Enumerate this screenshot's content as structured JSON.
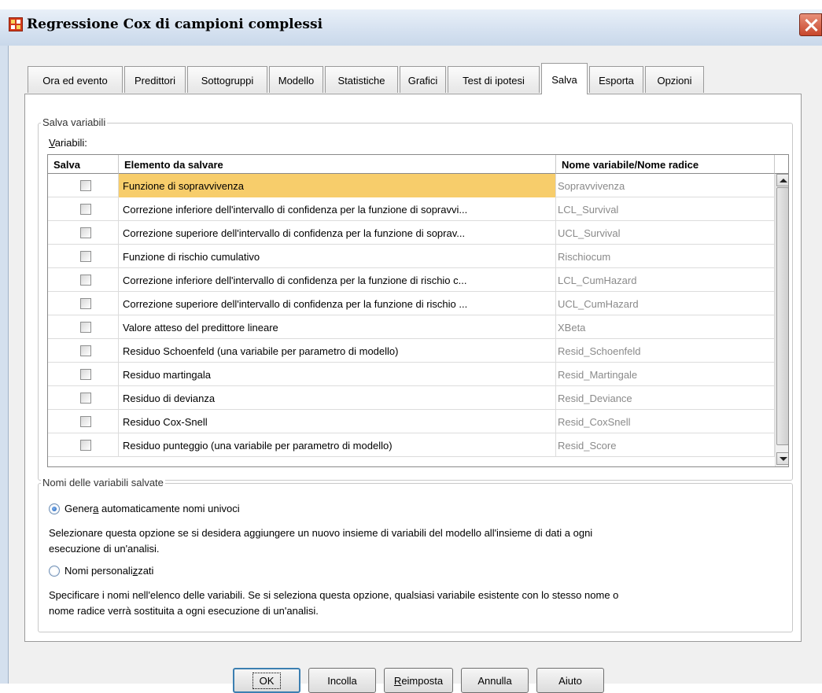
{
  "window": {
    "title": "Regressione Cox di campioni complessi"
  },
  "tabs": [
    {
      "label": "Ora ed evento"
    },
    {
      "label": "Predittori"
    },
    {
      "label": "Sottogruppi"
    },
    {
      "label": "Modello"
    },
    {
      "label": "Statistiche"
    },
    {
      "label": "Grafici"
    },
    {
      "label": "Test di ipotesi"
    },
    {
      "label": "Salva"
    },
    {
      "label": "Esporta"
    },
    {
      "label": "Opzioni"
    }
  ],
  "active_tab": "Salva",
  "save_variables": {
    "legend": "Salva variabili",
    "variables_label_prefix": "V",
    "variables_label_rest": "ariabili:",
    "columns": {
      "save": "Salva",
      "item": "Elemento da salvare",
      "name": "Nome variabile/Nome radice"
    },
    "rows": [
      {
        "checked": false,
        "item": "Funzione di sopravvivenza",
        "name": "Sopravvivenza",
        "selected": true
      },
      {
        "checked": false,
        "item": "Correzione inferiore dell'intervallo di confidenza per la funzione di sopravvi...",
        "name": "LCL_Survival"
      },
      {
        "checked": false,
        "item": "Correzione superiore dell'intervallo di confidenza per la funzione di soprav...",
        "name": "UCL_Survival"
      },
      {
        "checked": false,
        "item": "Funzione di rischio cumulativo",
        "name": "Rischiocum"
      },
      {
        "checked": false,
        "item": "Correzione inferiore dell'intervallo di confidenza per la funzione di rischio c...",
        "name": "LCL_CumHazard"
      },
      {
        "checked": false,
        "item": "Correzione superiore dell'intervallo di confidenza per la funzione di rischio ...",
        "name": "UCL_CumHazard"
      },
      {
        "checked": false,
        "item": "Valore atteso del predittore lineare",
        "name": "XBeta"
      },
      {
        "checked": false,
        "item": "Residuo Schoenfeld (una variabile per parametro di modello)",
        "name": "Resid_Schoenfeld"
      },
      {
        "checked": false,
        "item": "Residuo martingala",
        "name": "Resid_Martingale"
      },
      {
        "checked": false,
        "item": "Residuo di devianza",
        "name": "Resid_Deviance"
      },
      {
        "checked": false,
        "item": "Residuo Cox-Snell",
        "name": "Resid_CoxSnell"
      },
      {
        "checked": false,
        "item": "Residuo punteggio (una variabile per parametro di modello)",
        "name": "Resid_Score"
      }
    ]
  },
  "names_group": {
    "legend": "Nomi delle variabili salvate",
    "auto": {
      "label_a": "Gener",
      "label_u": "a",
      "label_b": " automaticamente nomi univoci",
      "selected": true,
      "description_1": "Selezionare questa opzione se si desidera aggiungere un nuovo insieme di variabili del modello all'insieme di dati a ogni",
      "description_2": "esecuzione di un'analisi."
    },
    "custom": {
      "label_a": "Nomi personali",
      "label_u": "z",
      "label_b": "zati",
      "selected": false,
      "description_1": "Specificare i nomi nell'elenco delle variabili. Se si seleziona questa opzione, qualsiasi variabile esistente con lo stesso nome o",
      "description_2": "nome radice verrà sostituita a ogni esecuzione di un'analisi."
    }
  },
  "buttons": {
    "ok": "OK",
    "paste": "Incolla",
    "reset_u": "R",
    "reset_rest": "eimposta",
    "cancel": "Annulla",
    "help": "Aiuto"
  }
}
